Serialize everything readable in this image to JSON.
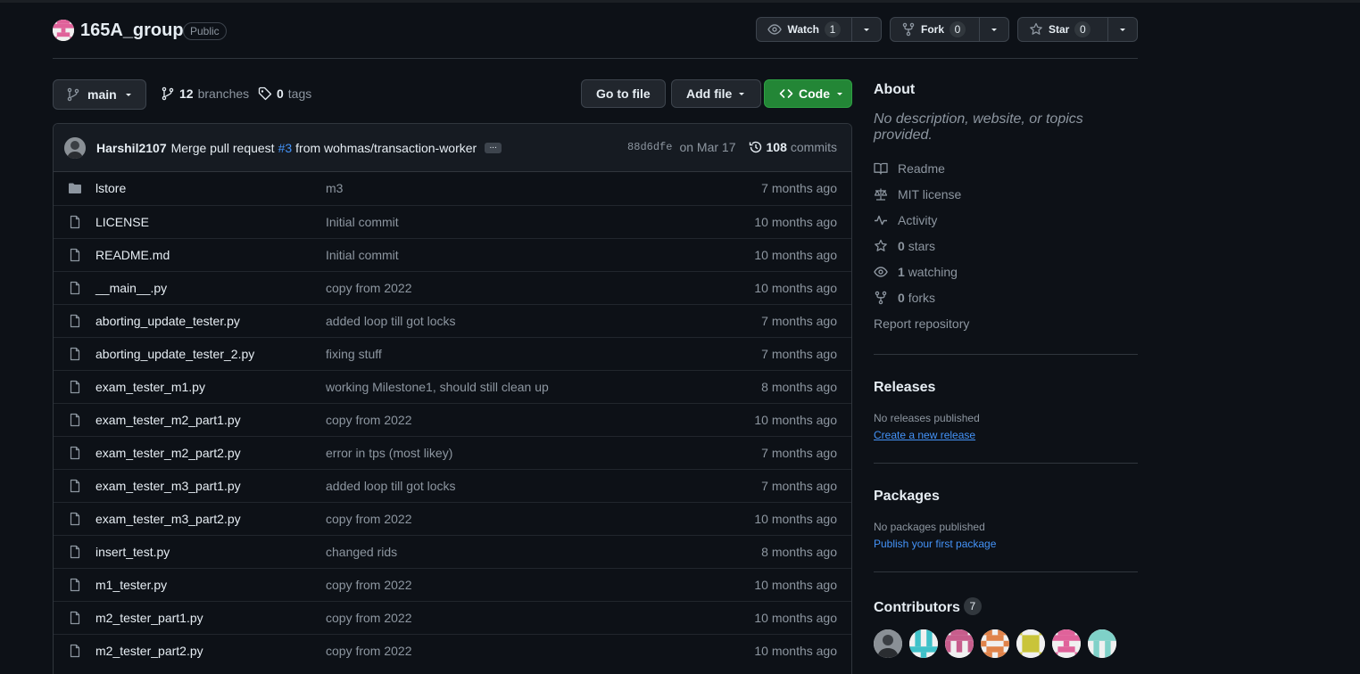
{
  "repo": {
    "name": "165A_group",
    "visibility": "Public",
    "watch_label": "Watch",
    "watch_count": "1",
    "fork_label": "Fork",
    "fork_count": "0",
    "star_label": "Star",
    "star_count": "0"
  },
  "toolbar": {
    "branch": "main",
    "branches_count": "12",
    "branches_label": "branches",
    "tags_count": "0",
    "tags_label": "tags",
    "go_to_file": "Go to file",
    "add_file": "Add file",
    "code": "Code"
  },
  "commit": {
    "author": "Harshil2107",
    "message_before": "Merge pull request",
    "pr_link": "#3",
    "message_after": "from wohmas/transaction-worker",
    "ellipsis": "...",
    "sha": "88d6dfe",
    "date": "on Mar 17",
    "count": "108",
    "count_label": "commits"
  },
  "files": [
    {
      "name": "lstore",
      "type": "dir",
      "message": "m3",
      "age": "7 months ago"
    },
    {
      "name": "LICENSE",
      "type": "file",
      "message": "Initial commit",
      "age": "10 months ago"
    },
    {
      "name": "README.md",
      "type": "file",
      "message": "Initial commit",
      "age": "10 months ago"
    },
    {
      "name": "__main__.py",
      "type": "file",
      "message": "copy from 2022",
      "age": "10 months ago"
    },
    {
      "name": "aborting_update_tester.py",
      "type": "file",
      "message": "added loop till got locks",
      "age": "7 months ago"
    },
    {
      "name": "aborting_update_tester_2.py",
      "type": "file",
      "message": "fixing stuff",
      "age": "7 months ago"
    },
    {
      "name": "exam_tester_m1.py",
      "type": "file",
      "message": "working Milestone1, should still clean up",
      "age": "8 months ago"
    },
    {
      "name": "exam_tester_m2_part1.py",
      "type": "file",
      "message": "copy from 2022",
      "age": "10 months ago"
    },
    {
      "name": "exam_tester_m2_part2.py",
      "type": "file",
      "message": "error in tps (most likey)",
      "age": "7 months ago"
    },
    {
      "name": "exam_tester_m3_part1.py",
      "type": "file",
      "message": "added loop till got locks",
      "age": "7 months ago"
    },
    {
      "name": "exam_tester_m3_part2.py",
      "type": "file",
      "message": "copy from 2022",
      "age": "10 months ago"
    },
    {
      "name": "insert_test.py",
      "type": "file",
      "message": "changed rids",
      "age": "8 months ago"
    },
    {
      "name": "m1_tester.py",
      "type": "file",
      "message": "copy from 2022",
      "age": "10 months ago"
    },
    {
      "name": "m2_tester_part1.py",
      "type": "file",
      "message": "copy from 2022",
      "age": "10 months ago"
    },
    {
      "name": "m2_tester_part2.py",
      "type": "file",
      "message": "copy from 2022",
      "age": "10 months ago"
    }
  ],
  "about": {
    "title": "About",
    "description": "No description, website, or topics provided.",
    "readme": "Readme",
    "license": "MIT license",
    "activity": "Activity",
    "stars_count": "0",
    "stars_label": "stars",
    "watching_count": "1",
    "watching_label": "watching",
    "forks_count": "0",
    "forks_label": "forks",
    "report": "Report repository"
  },
  "releases": {
    "title": "Releases",
    "empty": "No releases published",
    "create_link": "Create a new release"
  },
  "packages": {
    "title": "Packages",
    "empty": "No packages published",
    "publish_link": "Publish your first package"
  },
  "contributors": {
    "title": "Contributors",
    "count": "7"
  },
  "colors": {
    "background": "#0d1117",
    "accent_blue": "#4493f8",
    "code_green": "#238636",
    "muted": "#8d96a0"
  }
}
